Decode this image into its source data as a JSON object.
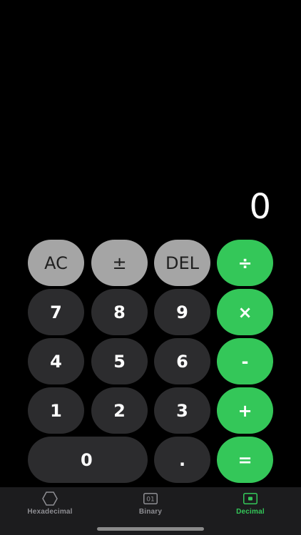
{
  "display": {
    "value": "0"
  },
  "keys": {
    "row1": [
      "AC",
      "±",
      "DEL",
      "÷"
    ],
    "row2": [
      "7",
      "8",
      "9",
      "×"
    ],
    "row3": [
      "4",
      "5",
      "6",
      "-"
    ],
    "row4": [
      "1",
      "2",
      "3",
      "+"
    ],
    "row5": [
      "0",
      ".",
      "="
    ]
  },
  "tabs": [
    {
      "label": "Hexadecimal",
      "icon": "hexagon-icon",
      "active": false
    },
    {
      "label": "Binary",
      "icon": "binary-01-icon",
      "active": false
    },
    {
      "label": "Decimal",
      "icon": "decimal-square-icon",
      "active": true
    }
  ],
  "colors": {
    "background": "#000000",
    "function_key": "#a5a5a5",
    "digit_key": "#2c2c2e",
    "operator_key": "#34c759",
    "tabbar": "#1c1c1e",
    "inactive_tab": "#8e8e93",
    "active_tab": "#34c759"
  }
}
